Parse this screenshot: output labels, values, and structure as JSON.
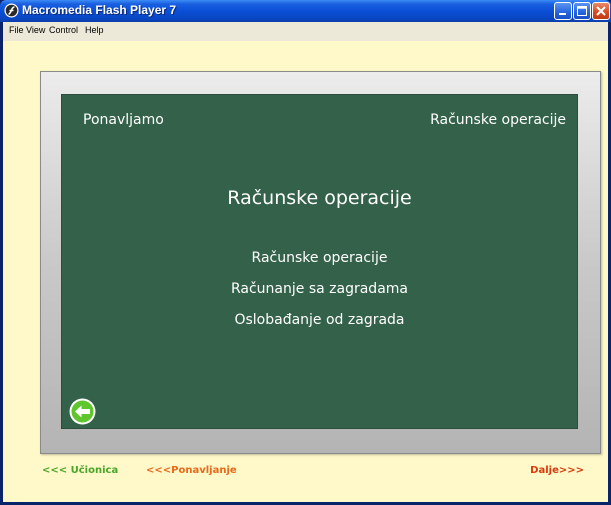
{
  "window": {
    "title": "Macromedia Flash Player 7",
    "app_icon": "flash-player-icon",
    "controls": [
      "minimize-icon",
      "maximize-icon",
      "close-icon"
    ]
  },
  "menubar": {
    "items": [
      {
        "label": "File"
      },
      {
        "label": "View"
      },
      {
        "label": "Control"
      },
      {
        "label": "Help"
      }
    ]
  },
  "board": {
    "top_left": "Ponavljamo",
    "top_right": "Računske operacije",
    "heading": "Računske operacije",
    "links": [
      {
        "label": "Računske operacije"
      },
      {
        "label": "Računanje sa zagradama"
      },
      {
        "label": "Oslobađanje od zagrada"
      }
    ],
    "back_icon": "arrow-left-circle-icon"
  },
  "footer": {
    "ucionica": "<<< Učionica",
    "ponavljanje": "<<<Ponavljanje",
    "dalje": "Dalje>>>"
  },
  "colors": {
    "board_green": "#336149",
    "content_bg": "#fff8c8",
    "link_green": "#4aa52a",
    "link_orange": "#e86a1a",
    "link_red": "#d83a0c"
  }
}
